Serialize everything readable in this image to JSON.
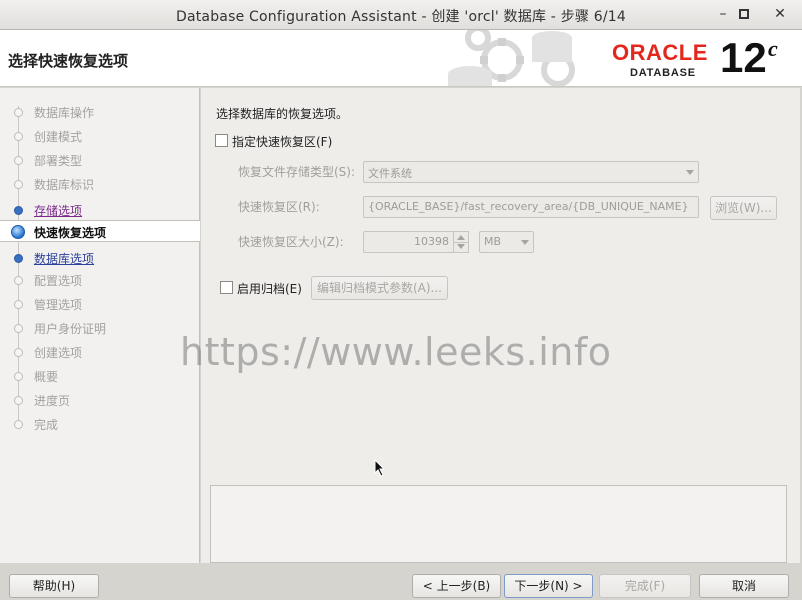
{
  "window": {
    "title": "Database Configuration Assistant - 创建 'orcl' 数据库 - 步骤 6/14",
    "minimize_glyph": "–",
    "maximize_glyph": "▫",
    "close_glyph": "✕"
  },
  "header": {
    "page_title": "选择快速恢复选项",
    "brand_name": "ORACLE",
    "brand_sub": "DATABASE",
    "version": "12",
    "version_suffix": "c"
  },
  "sidebar": {
    "steps": [
      {
        "label": "数据库操作",
        "state": "disabled"
      },
      {
        "label": "创建模式",
        "state": "disabled"
      },
      {
        "label": "部署类型",
        "state": "disabled"
      },
      {
        "label": "数据库标识",
        "state": "disabled"
      },
      {
        "label": "存储选项",
        "state": "visited"
      },
      {
        "label": "快速恢复选项",
        "state": "current"
      },
      {
        "label": "数据库选项",
        "state": "link"
      },
      {
        "label": "配置选项",
        "state": "disabled"
      },
      {
        "label": "管理选项",
        "state": "disabled"
      },
      {
        "label": "用户身份证明",
        "state": "disabled"
      },
      {
        "label": "创建选项",
        "state": "disabled"
      },
      {
        "label": "概要",
        "state": "disabled"
      },
      {
        "label": "进度页",
        "state": "disabled"
      },
      {
        "label": "完成",
        "state": "disabled"
      }
    ]
  },
  "content": {
    "intro": "选择数据库的恢复选项。",
    "fra_checkbox_label": "指定快速恢复区(F)",
    "fra_checked": false,
    "storage_type_label": "恢复文件存储类型(S):",
    "storage_type_value": "文件系统",
    "fra_location_label": "快速恢复区(R):",
    "fra_location_value": "{ORACLE_BASE}/fast_recovery_area/{DB_UNIQUE_NAME}",
    "browse_button": "浏览(W)...",
    "fra_size_label": "快速恢复区大小(Z):",
    "fra_size_value": "10398",
    "fra_unit_value": "MB",
    "archive_checkbox_label": "启用归档(E)",
    "archive_checked": false,
    "edit_archive_button": "编辑归档模式参数(A)..."
  },
  "watermark": "https://www.leeks.info",
  "footer": {
    "help_button": "帮助(H)",
    "back_button": "< 上一步(B)",
    "next_button": "下一步(N) >",
    "finish_button": "完成(F)",
    "cancel_button": "取消"
  },
  "colors": {
    "oracle_red": "#e3271c",
    "link_blue": "#2a3f9a",
    "visited_purple": "#7a2a8a"
  }
}
